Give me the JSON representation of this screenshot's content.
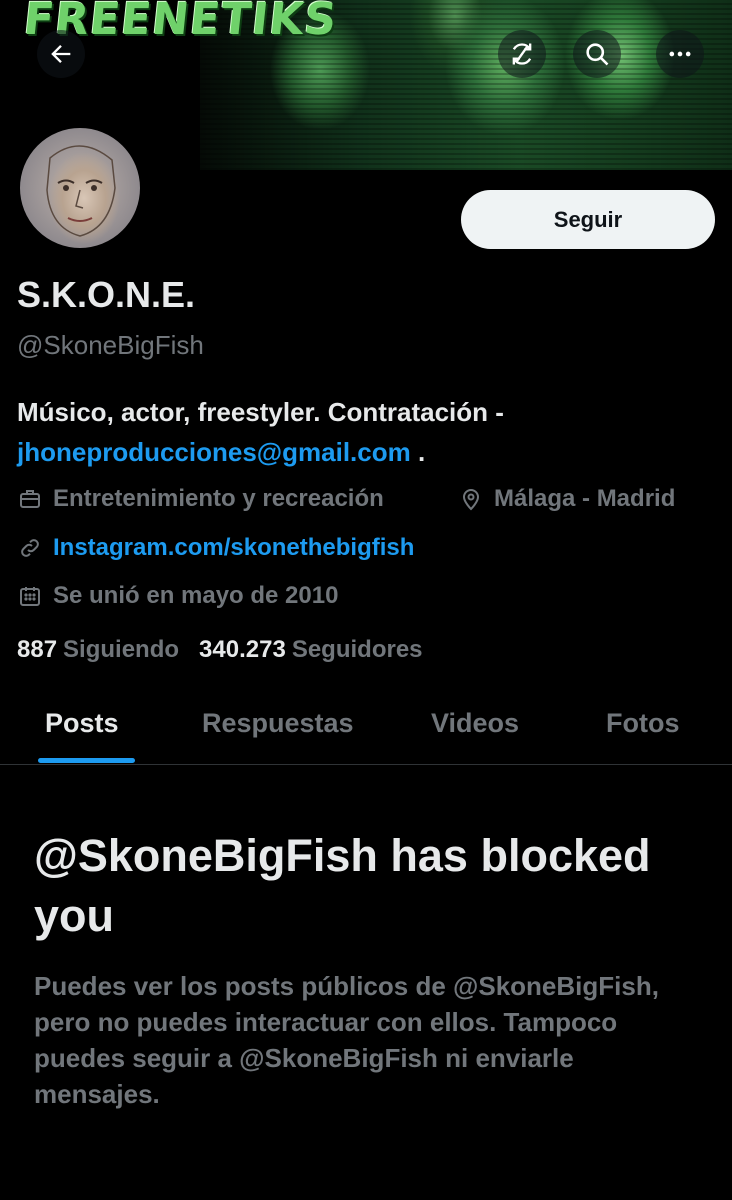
{
  "banner": {
    "logo_text": "FREENETIKS"
  },
  "header": {
    "back_icon": "arrow-left-icon",
    "actions": [
      "refresh-icon",
      "search-icon",
      "more-icon"
    ]
  },
  "profile": {
    "name": "S.K.O.N.E.",
    "handle": "@SkoneBigFish",
    "follow_button": "Seguir",
    "bio_text": "Músico, actor, freestyler. Contratación -",
    "bio_email": "jhoneproducciones@gmail.com",
    "bio_trailing": " .",
    "category": "Entretenimiento y recreación",
    "location": "Málaga - Madrid",
    "website": "Instagram.com/skonethebigfish",
    "joined": "Se unió en mayo de 2010",
    "following_count": "887",
    "following_label": "Siguiendo",
    "followers_count": "340.273",
    "followers_label": "Seguidores"
  },
  "tabs": [
    {
      "label": "Posts",
      "active": true
    },
    {
      "label": "Respuestas",
      "active": false
    },
    {
      "label": "Videos",
      "active": false
    },
    {
      "label": "Fotos",
      "active": false
    }
  ],
  "blocked": {
    "title": "@SkoneBigFish has blocked you",
    "message": "Puedes ver los posts públicos de @SkoneBigFish, pero no puedes interactuar con ellos. Tampoco puedes seguir a @SkoneBigFish ni enviarle mensajes."
  },
  "colors": {
    "background": "#000000",
    "text": "#e7e9ea",
    "secondary": "#71767b",
    "accent": "#1d9bf0",
    "button_bg": "#eff3f4"
  }
}
